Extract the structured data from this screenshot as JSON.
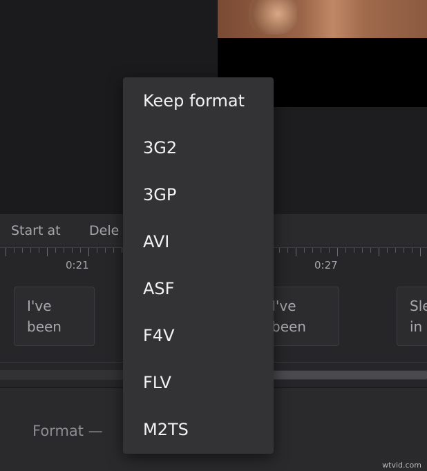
{
  "toolbar": {
    "start_at_label": "Start at",
    "delete_label": "Dele"
  },
  "timeline": {
    "time_labels": [
      "0:21",
      "0:27"
    ]
  },
  "clips": [
    {
      "line1": "I've",
      "line2": "been"
    },
    {
      "line1": "I've",
      "line2": "been"
    },
    {
      "line1": "Sle",
      "line2": "in"
    }
  ],
  "settings": {
    "format_label": "Format —"
  },
  "format_dropdown": {
    "options": [
      "Keep format",
      "3G2",
      "3GP",
      "AVI",
      "ASF",
      "F4V",
      "FLV",
      "M2TS"
    ]
  },
  "watermark": "wtvid.com"
}
